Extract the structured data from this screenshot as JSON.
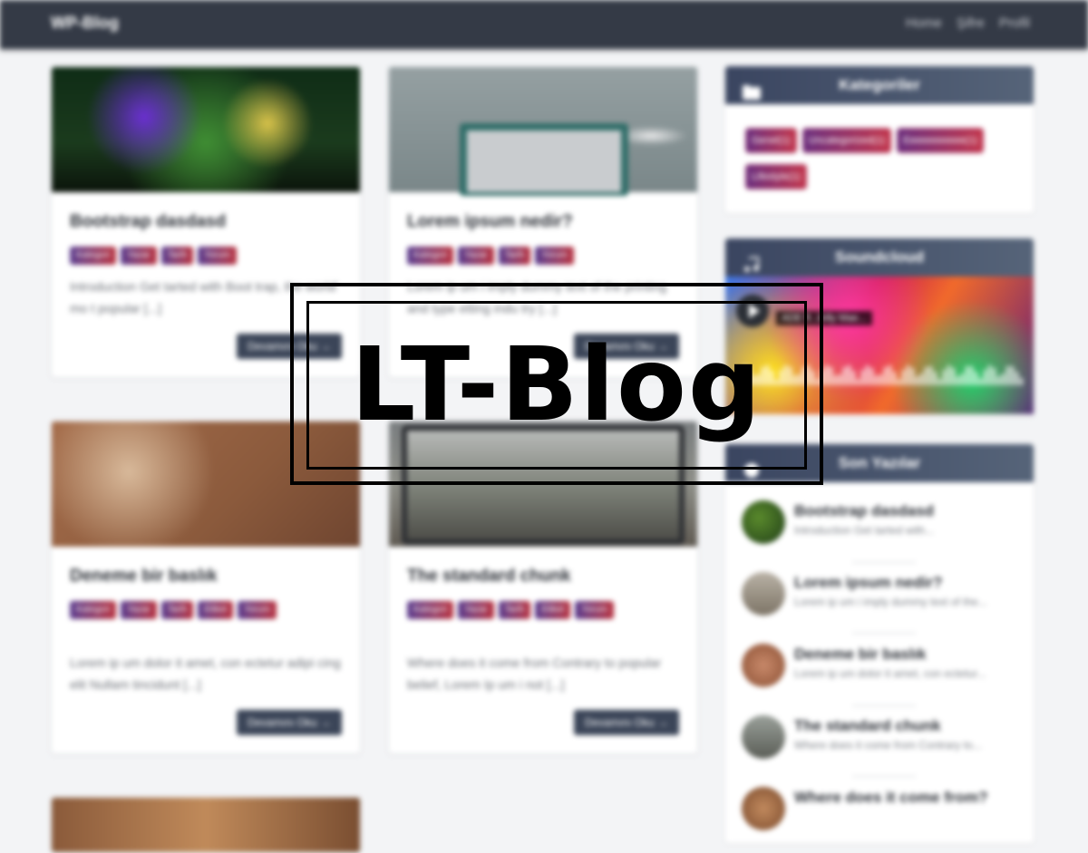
{
  "navbar": {
    "brand": "WP-Blog",
    "links": [
      "Home",
      "Şifre",
      "Profil"
    ]
  },
  "posts": [
    {
      "title": "Bootstrap dasdasd",
      "badges": [
        "Kategori",
        "Yazar",
        "Tarih",
        "Yorum"
      ],
      "excerpt": "Introduction Get tarted with Boot trap, the world' mo t popular [...]",
      "more": "Devamını Oku →"
    },
    {
      "title": "Lorem ipsum nedir?",
      "badges": [
        "Kategori",
        "Yazar",
        "Tarih",
        "Yorum"
      ],
      "excerpt": "Lorem ip um i imply dummy text of the printing and type etting indu try [...]",
      "more": "Devamını Oku →"
    },
    {
      "title": "Deneme bir baslık",
      "badges": [
        "Kategori",
        "Yazar",
        "Tarih",
        "Etiket",
        "Yorum"
      ],
      "excerpt": "Lorem ip um dolor it amet, con ectetur adipi cing elit Nullam tincidunt [...]",
      "more": "Devamını Oku →"
    },
    {
      "title": "The standard chunk",
      "badges": [
        "Kategori",
        "Yazar",
        "Tarih",
        "Etiket",
        "Yorum"
      ],
      "excerpt": "Where does it come from Contrary to popular belief, Lorem Ip um i not [...]",
      "more": "Devamını Oku →"
    }
  ],
  "sidebar": {
    "categories": {
      "title": "Kategoriler",
      "items": [
        "Genel(1)",
        "Uncategorized(1)",
        "Eeeeeeeeeee(1)",
        "Lifestyle(1)"
      ]
    },
    "soundcloud": {
      "title": "Soundcloud",
      "track": "ADE ft. Jolly Mae..."
    },
    "recent": {
      "title": "Son Yazılar",
      "items": [
        {
          "title": "Bootstrap dasdasd",
          "desc": "Introduction Get tarted with..."
        },
        {
          "title": "Lorem ipsum nedir?",
          "desc": "Lorem ip um i imply dummy text of the..."
        },
        {
          "title": "Deneme bir baslık",
          "desc": "Lorem ip um dolor it amet, con ectetur..."
        },
        {
          "title": "The standard chunk",
          "desc": "Where does it come from Contrary to..."
        },
        {
          "title": "Where does it come from?",
          "desc": ""
        }
      ]
    }
  },
  "overlay": {
    "logo": "LT-Blog"
  }
}
